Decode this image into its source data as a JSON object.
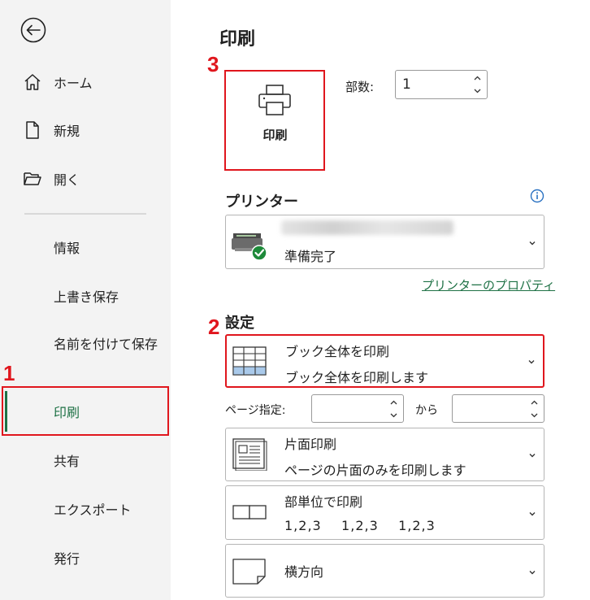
{
  "sidebar": {
    "back_icon": "back-arrow-icon",
    "items": [
      {
        "label": "ホーム",
        "icon": "home-icon"
      },
      {
        "label": "新規",
        "icon": "new-document-icon"
      },
      {
        "label": "開く",
        "icon": "open-folder-icon"
      },
      {
        "label": "情報"
      },
      {
        "label": "上書き保存"
      },
      {
        "label": "名前を付けて保存"
      },
      {
        "label": "印刷",
        "selected": true
      },
      {
        "label": "共有"
      },
      {
        "label": "エクスポート"
      },
      {
        "label": "発行"
      }
    ]
  },
  "markers": {
    "one": "1",
    "two": "2",
    "three": "3"
  },
  "main": {
    "title": "印刷",
    "print_button_label": "印刷",
    "copies_label": "部数:",
    "copies_value": "1",
    "printer_heading": "プリンター",
    "printer_status": "準備完了",
    "printer_properties_link": "プリンターのプロパティ",
    "settings_heading": "設定",
    "settings": [
      {
        "main": "ブック全体を印刷",
        "sub": "ブック全体を印刷します",
        "icon": "grid-sheet-icon"
      },
      {
        "main": "片面印刷",
        "sub": "ページの片面のみを印刷します",
        "icon": "single-side-icon"
      },
      {
        "main": "部単位で印刷",
        "sub": "1,2,3    1,2,3    1,2,3",
        "icon": "collate-icon"
      },
      {
        "main": "横方向",
        "sub": "",
        "icon": "landscape-icon"
      }
    ],
    "page_range_label": "ページ指定:",
    "page_range_from_label": "から"
  },
  "colors": {
    "accent": "#1e7145",
    "highlight": "#e0161d",
    "sidebar_bg": "#f3f3f3"
  }
}
